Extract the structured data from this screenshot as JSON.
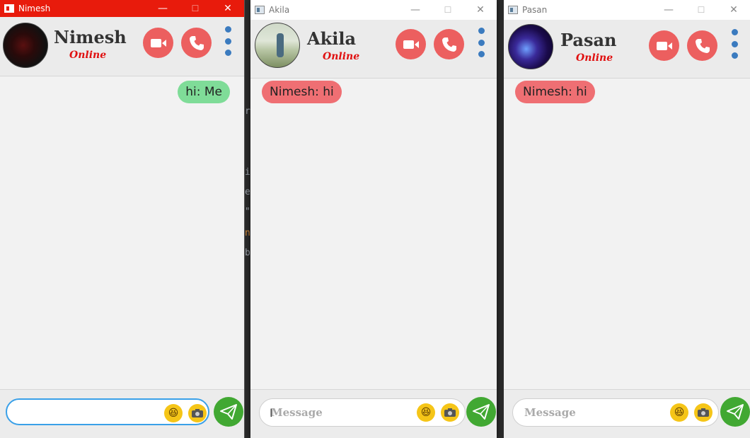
{
  "windows": [
    {
      "title": "Nimesh",
      "contact": {
        "name": "Nimesh",
        "status": "Online"
      },
      "messages": [
        {
          "text": "hi: Me",
          "direction": "out"
        }
      ],
      "input": {
        "value": "",
        "placeholder": ""
      }
    },
    {
      "title": "Akila",
      "contact": {
        "name": "Akila",
        "status": "Online"
      },
      "messages": [
        {
          "text": "Nimesh: hi",
          "direction": "in"
        }
      ],
      "input": {
        "value": "",
        "placeholder": "Message"
      }
    },
    {
      "title": "Pasan",
      "contact": {
        "name": "Pasan",
        "status": "Online"
      },
      "messages": [
        {
          "text": "Nimesh: hi",
          "direction": "in"
        }
      ],
      "input": {
        "value": "",
        "placeholder": "Message"
      }
    }
  ],
  "window_controls": {
    "minimize": "—",
    "maximize": "☐",
    "close": "✕"
  },
  "background_code": [
    "r",
    "i",
    "e",
    "\"",
    "n",
    "b"
  ],
  "icons": {
    "video": "video-camera-icon",
    "call": "phone-icon",
    "menu": "more-vertical-icon",
    "emoji": "laughing-emoji-icon",
    "camera": "camera-icon",
    "send": "paper-plane-icon"
  },
  "colors": {
    "titlebar_active": "#e81b0c",
    "action_buttons": "#ec5f5f",
    "outgoing_bubble": "#7fdc98",
    "incoming_bubble": "#ef6f73",
    "send_button": "#41a832",
    "status_text": "#e01010",
    "menu_dots": "#3b7bbf"
  }
}
